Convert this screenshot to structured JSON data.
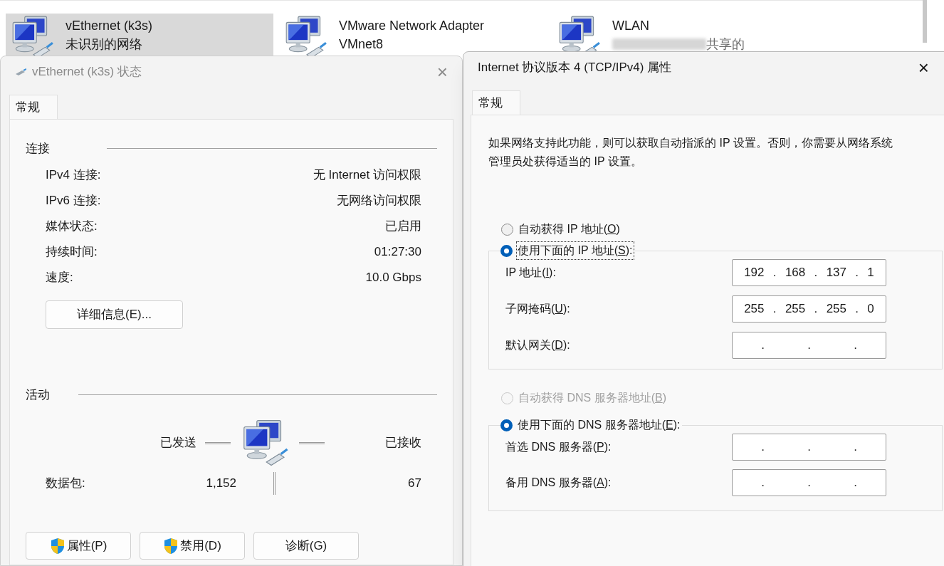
{
  "adapters": [
    {
      "name": "vEthernet (k3s)",
      "status": "未识别的网络",
      "redacted": false,
      "selected": true
    },
    {
      "name": "VMware Network Adapter VMnet8",
      "redacted": false,
      "selected": false
    },
    {
      "name": "WLAN",
      "status": "共享的",
      "redacted": true,
      "selected": false
    }
  ],
  "status_dialog": {
    "title": "vEthernet (k3s) 状态",
    "active": false,
    "close": "×",
    "tabs": [
      {
        "label": "常规",
        "selected": true
      }
    ],
    "connection": {
      "heading": "连接",
      "rows": [
        {
          "label": "IPv4 连接:",
          "value": "无 Internet 访问权限"
        },
        {
          "label": "IPv6 连接:",
          "value": "无网络访问权限"
        },
        {
          "label": "媒体状态:",
          "value": "已启用"
        },
        {
          "label": "持续时间:",
          "value": "01:27:30"
        },
        {
          "label": "速度:",
          "value": "10.0 Gbps"
        }
      ]
    },
    "details_button": "详细信息(E)...",
    "activity": {
      "heading": "活动",
      "sent_label": "已发送",
      "received_label": "已接收",
      "packets_label": "数据包:",
      "sent": "1,152",
      "received": "67"
    },
    "buttons": [
      {
        "label": "属性(P)",
        "shield": true
      },
      {
        "label": "禁用(D)",
        "shield": true
      },
      {
        "label": "诊断(G)",
        "shield": false
      }
    ]
  },
  "ipv4_dialog": {
    "title": "Internet 协议版本 4 (TCP/IPv4) 属性",
    "active": true,
    "close": "×",
    "tabs": [
      {
        "label": "常规",
        "selected": true
      }
    ],
    "description": "如果网络支持此功能，则可以获取自动指派的 IP 设置。否则，你需要从网络系统管理员处获得适当的 IP 设置。",
    "ip_auto": {
      "label_parts": [
        "自动获得 IP 地址(",
        "O",
        ")"
      ],
      "selected": false,
      "disabled": false,
      "focused": false
    },
    "ip_manual": {
      "label_parts": [
        "使用下面的 IP 地址(",
        "S",
        "):"
      ],
      "selected": true,
      "disabled": false,
      "focused": true
    },
    "ip_fields": [
      {
        "label_parts": [
          "IP 地址(",
          "I",
          "):"
        ],
        "segments": [
          "192",
          ".",
          "168",
          ".",
          "137",
          ".",
          "1"
        ]
      },
      {
        "label_parts": [
          "子网掩码(",
          "U",
          "):"
        ],
        "segments": [
          "255",
          ".",
          "255",
          ".",
          "255",
          ".",
          "0"
        ]
      },
      {
        "label_parts": [
          "默认网关(",
          "D",
          "):"
        ],
        "segments": [
          ".",
          ".",
          "."
        ]
      }
    ],
    "dns_auto": {
      "label_parts": [
        "自动获得 DNS 服务器地址(",
        "B",
        ")"
      ],
      "selected": false,
      "disabled": true,
      "focused": false
    },
    "dns_manual": {
      "label_parts": [
        "使用下面的 DNS 服务器地址(",
        "E",
        "):"
      ],
      "selected": true,
      "disabled": false,
      "focused": false
    },
    "dns_fields": [
      {
        "label_parts": [
          "首选 DNS 服务器(",
          "P",
          "):"
        ],
        "segments": [
          ".",
          ".",
          "."
        ]
      },
      {
        "label_parts": [
          "备用 DNS 服务器(",
          "A",
          "):"
        ],
        "segments": [
          ".",
          ".",
          "."
        ]
      }
    ]
  }
}
